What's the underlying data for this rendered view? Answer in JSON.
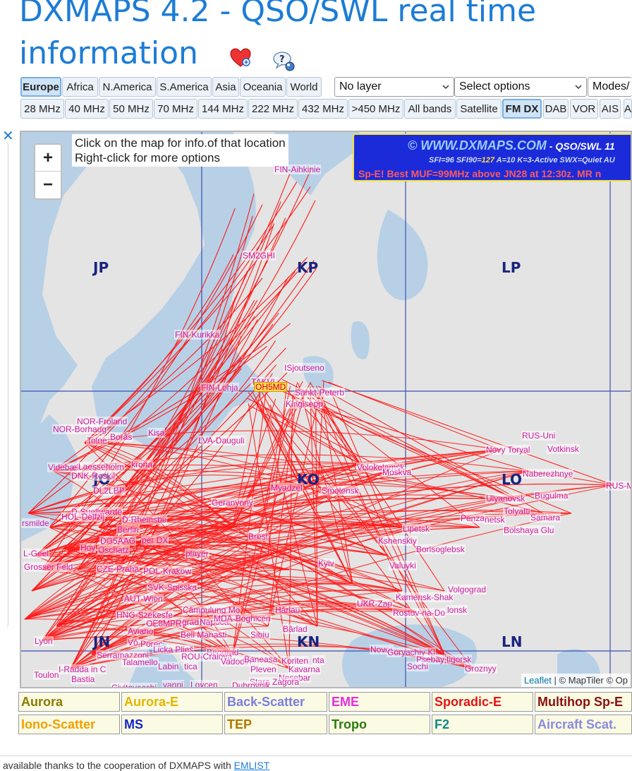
{
  "header": {
    "title_line1": "DXMAPS 4.2 - QSO/SWL real time",
    "title_line2": "information"
  },
  "region_tabs": [
    "Europe",
    "Africa",
    "N.America",
    "S.America",
    "Asia",
    "Oceania",
    "World"
  ],
  "active_region": "Europe",
  "selects": {
    "layer": "No layer",
    "options": "Select options",
    "modes": "Modes/"
  },
  "band_tabs": [
    "28 MHz",
    "40 MHz",
    "50 MHz",
    "70 MHz",
    "144 MHz",
    "222 MHz",
    "432 MHz",
    ">450 MHz",
    "All bands",
    "Satellite",
    "FM DX",
    "DAB",
    "VOR",
    "AIS",
    "A"
  ],
  "active_band": "FM DX",
  "map": {
    "zoom_in": "+",
    "zoom_out": "−",
    "tooltip_line1": "Click on the map for info.of that location",
    "tooltip_line2": "Right-click for more options",
    "banner_site": "© WWW.DXMAPS.COM",
    "banner_site_suffix": " - QSO/SWL 11",
    "banner_sfi": "SFI=96",
    "banner_sfi90": "SFI90=",
    "banner_sfi90_val": "127",
    "banner_rest": "A=10 K=3-Active SWX=Quiet AU",
    "banner_alert": "Sp-E! Best MUF=99MHz above JN28 at 12:30z. MR n",
    "grid_labels": [
      "JP",
      "KP",
      "LP",
      "JO",
      "KO",
      "LO",
      "JN",
      "KN",
      "LN"
    ],
    "home_station": "OH5MD",
    "attribution_leaflet": "Leaflet",
    "attribution_maptiler": "© MapTiler",
    "attribution_op": "© Op",
    "cities": [
      "FIN-Aihkinie",
      "SM2GHI",
      "FIN-Kurikka",
      "ISjoutseno",
      "TAKVL",
      "FIN-Lohja",
      "Sankt-Peterb",
      "Kingisepp",
      "NOR-Froland",
      "NOR-Borhaug",
      "Borås",
      "Kisa",
      "Tolne",
      "LVA-Dauguli",
      "Videbæk",
      "Laesseholm",
      "krona",
      "DNK-Roskil",
      "DL2LBP",
      "Myadzel",
      "Smolensk",
      "Volokolamsk",
      "Moskva",
      "Geranyony",
      "D-Suellwarde",
      "HOL-Delfzij",
      "D-Rheinsbe",
      "rsmilde",
      "Berlin",
      "DG5AAG",
      "per DX",
      "Brest",
      "Lipetsk",
      "Kshenskiy",
      "Hoy",
      "Oschatz",
      "player",
      "L-Geel",
      "Grosser Feld",
      "CZE-Praha",
      "POL-Krakow",
      "Kyiv",
      "Valuyki",
      "Borisoglebsk",
      "SVK-Spisska",
      "AUT-Wien",
      "Câmpulung Mo",
      "Hârlau",
      "UKR-Zap",
      "Kamensk-Shak",
      "Volgograd",
      "Rostov-na-Do",
      "lonsk",
      "HNG-Szekesfe",
      "OE8MPR",
      "grad",
      "Napoca",
      "MDA-Boghicen",
      "Lyon",
      "Aviano",
      "Vò",
      "Porec",
      "Beli Manasti",
      "Sibiu",
      "Bârlad",
      "Serramazzoni",
      "Talamello",
      "Licka Plieš",
      "Beograd",
      "ROU-Craiova",
      "Vadodin",
      "Baneasa",
      "Koriten",
      "nta",
      "Novor",
      "Goryachiy Kl",
      "Psebay",
      "tigorsk",
      "Sochi",
      "Groznyy",
      "Toulon",
      "I-Radda in C",
      "Bastia",
      "Labin",
      "tica",
      "Pleven",
      "Kavarna",
      "Nesebar",
      "Stara Zagora",
      "Civitavecchi",
      "vanni",
      "Lovcen",
      "Dubrovnik",
      "RUS-Uni",
      "Novy Toryal",
      "Votkinsk",
      "Naberezhnye",
      "RUS-M",
      "Ulyanovsk",
      "Bugulma",
      "Penza",
      "netsk",
      "Tolyatti",
      "Samara",
      "Bolshaya Glu"
    ]
  },
  "legend": [
    {
      "label": "Aurora",
      "color": "#8a7a00"
    },
    {
      "label": "Aurora-E",
      "color": "#e1b500"
    },
    {
      "label": "Back-Scatter",
      "color": "#7a7ee0"
    },
    {
      "label": "EME",
      "color": "#e22fe0"
    },
    {
      "label": "Sporadic-E",
      "color": "#e21515"
    },
    {
      "label": "Multihop Sp-E",
      "color": "#8a1010"
    },
    {
      "label": "Iono-Scatter",
      "color": "#f0a000"
    },
    {
      "label": "MS",
      "color": "#1525c8"
    },
    {
      "label": "TEP",
      "color": "#b07800"
    },
    {
      "label": "Tropo",
      "color": "#2a7a10"
    },
    {
      "label": "F2",
      "color": "#0f8a8a"
    },
    {
      "label": "Aircraft Scat.",
      "color": "#8a8ae0"
    }
  ],
  "footer": {
    "text": "available thanks to the cooperation of DXMAPS with ",
    "link": "EMLIST"
  },
  "colors": {
    "title": "#1c7cd6",
    "path": "#ff1a1a",
    "city": "#d01aa0",
    "grid": "#3a4fb0"
  }
}
